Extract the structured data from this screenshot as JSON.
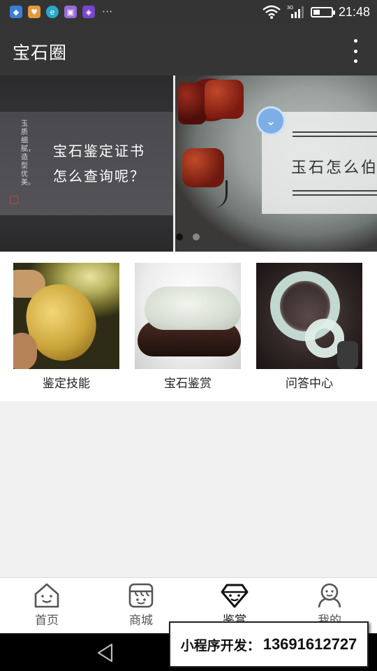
{
  "status_bar": {
    "time": "21:48",
    "network": "3G",
    "app_icons": [
      "app-icon-1",
      "app-icon-2",
      "app-icon-3",
      "app-icon-4",
      "app-icon-5"
    ],
    "more_glyph": "···"
  },
  "app": {
    "title": "宝石圈"
  },
  "banner": {
    "slide1": {
      "vertical_text": "玉质细腻，造型优美。",
      "line1": "宝石鉴定证书",
      "line2": "怎么查询呢？"
    },
    "slide2": {
      "text": "玉石怎么伯"
    },
    "pager": {
      "count": 2,
      "active": 0
    }
  },
  "categories": [
    {
      "label": "鉴定技能"
    },
    {
      "label": "宝石鉴赏"
    },
    {
      "label": "问答中心"
    }
  ],
  "tabs": [
    {
      "label": "首页",
      "icon": "home-icon"
    },
    {
      "label": "商城",
      "icon": "shop-icon"
    },
    {
      "label": "鉴赏",
      "icon": "diamond-icon",
      "active": true
    },
    {
      "label": "我的",
      "icon": "profile-icon"
    }
  ],
  "watermark": {
    "prefix": "小程序开发：",
    "phone": "13691612727"
  },
  "colors": {
    "header_bg": "#353535",
    "page_bg": "#f0f0f0",
    "tab_bg": "#ffffff"
  }
}
